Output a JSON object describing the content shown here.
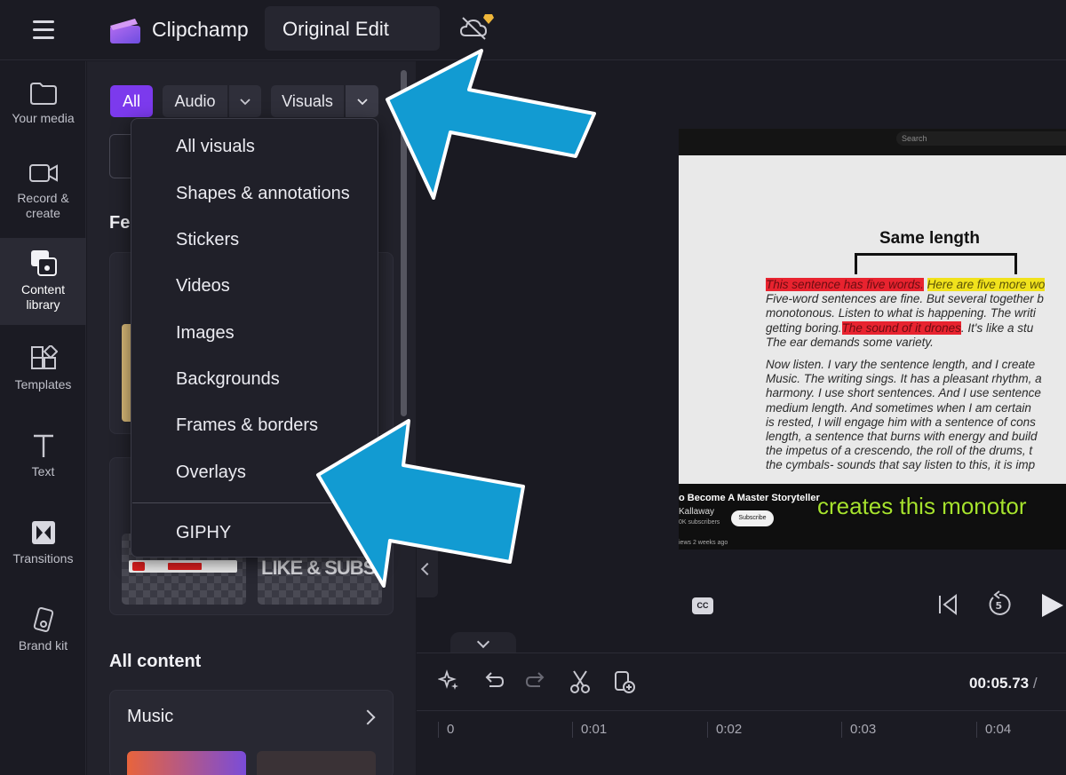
{
  "app": {
    "name": "Clipchamp",
    "project_name": "Original Edit"
  },
  "rail": {
    "items": [
      {
        "label": "Your media",
        "icon": "folder-icon"
      },
      {
        "label": "Record &\ncreate",
        "icon": "video-camera-icon"
      },
      {
        "label": "Content\nlibrary",
        "icon": "content-library-icon",
        "active": true
      },
      {
        "label": "Templates",
        "icon": "templates-icon"
      },
      {
        "label": "Text",
        "icon": "text-icon"
      },
      {
        "label": "Transitions",
        "icon": "transitions-icon"
      },
      {
        "label": "Brand kit",
        "icon": "brand-kit-icon"
      }
    ]
  },
  "panel": {
    "tabs": {
      "all": "All",
      "audio": "Audio",
      "visuals": "Visuals"
    },
    "featured_label_partial": "Fe",
    "all_content_label": "All content",
    "music_label": "Music",
    "sticker_text": "LIKE & SUBSCRIBE"
  },
  "dropdown": {
    "items": [
      "All visuals",
      "Shapes & annotations",
      "Stickers",
      "Videos",
      "Images",
      "Backgrounds",
      "Frames & borders",
      "Overlays"
    ],
    "extra_item": "GIPHY"
  },
  "video": {
    "search_placeholder": "Search",
    "heading": "Same length",
    "hl1": "This sentence has five words.",
    "hl2": "Here are five more wo",
    "line2": "Five-word sentences are fine. But several together b",
    "line3": "monotonous. Listen to what is happening. The writi",
    "line4a": "getting boring.",
    "hl3": "The sound of it drones",
    "line4b": ". It's like a stu",
    "line5": "The ear demands some variety.",
    "para2": [
      "Now listen. I vary the sentence length, and I create",
      "Music. The writing sings. It has a pleasant rhythm, a",
      "harmony. I use short sentences. And I use sentence",
      "medium length. And sometimes when I am certain",
      "is rested, I will engage him with a sentence of cons",
      "length, a sentence that burns with energy and build",
      "the impetus of a crescendo, the roll of the drums, t",
      "the cymbals- sounds that say listen to this, it is imp"
    ],
    "yt_title": "o Become A Master Storyteller",
    "yt_channel": "Kallaway",
    "yt_subs": "0K subscribers",
    "yt_subscribe": "Subscribe",
    "yt_views": "iews  2 weeks ago",
    "caption": "creates this monotor"
  },
  "player": {
    "cc_label": "CC"
  },
  "timeline": {
    "current_time": "00:05.73",
    "separator": " / ",
    "ticks": [
      "0",
      "0:01",
      "0:02",
      "0:03",
      "0:04"
    ]
  },
  "colors": {
    "accent": "#7c3aed",
    "callout_arrow": "#129bd2",
    "highlight_red": "#e8232f",
    "highlight_yellow": "#f1e21c",
    "caption_green": "#a6e22e"
  }
}
